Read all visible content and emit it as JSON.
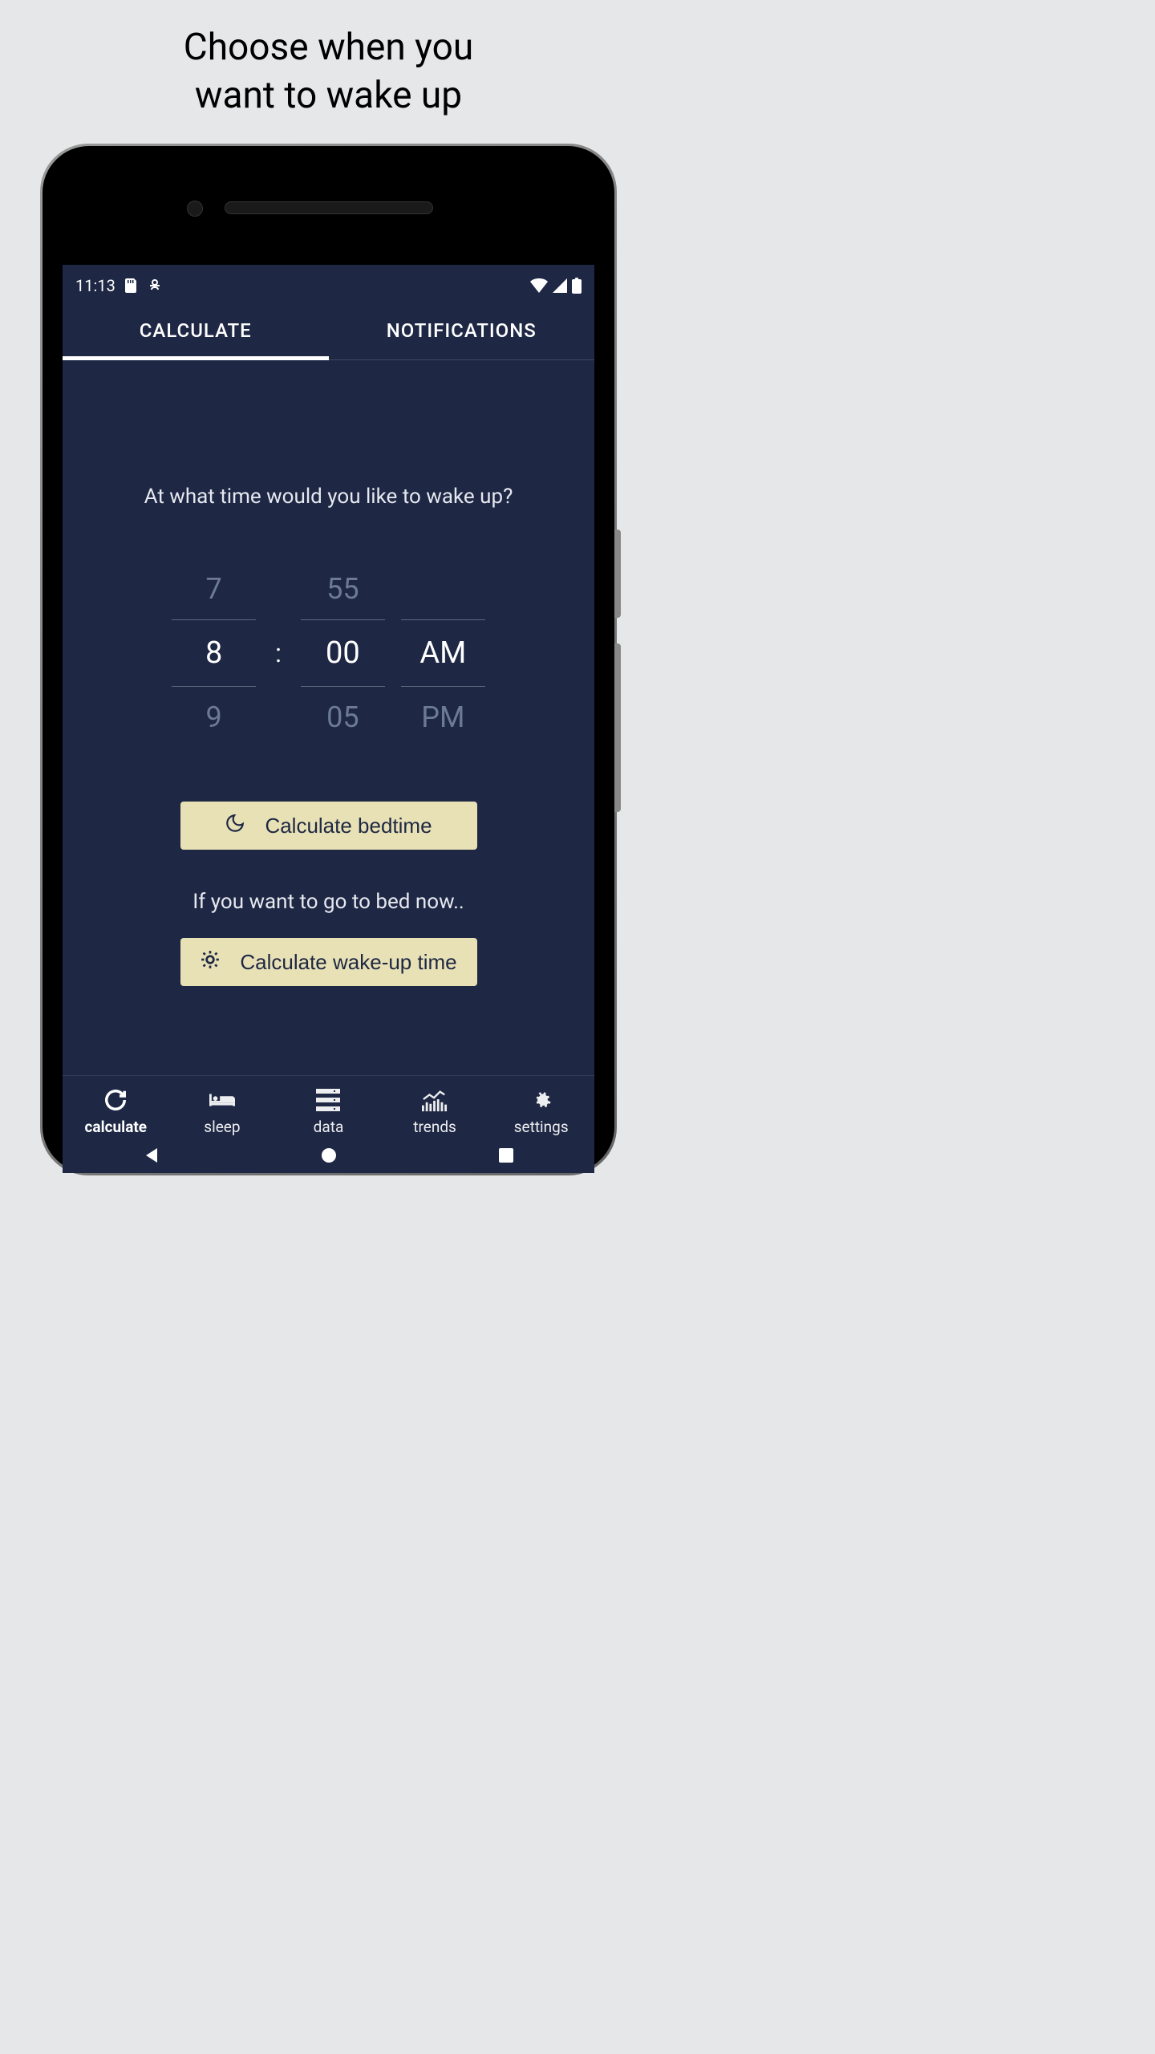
{
  "page_title_line1": "Choose when you",
  "page_title_line2": "want to wake up",
  "status_bar": {
    "time": "11:13"
  },
  "tabs": {
    "calculate": "CALCULATE",
    "notifications": "NOTIFICATIONS"
  },
  "question": "At what time would you like to wake up?",
  "time_picker": {
    "hour_prev": "7",
    "hour_selected": "8",
    "hour_next": "9",
    "minute_prev": "55",
    "minute_selected": "00",
    "minute_next": "05",
    "period_selected": "AM",
    "period_next": "PM",
    "separator": ":"
  },
  "buttons": {
    "calculate_bedtime": "Calculate bedtime",
    "calculate_wakeup": "Calculate wake-up time"
  },
  "alt_text": "If you want to go to bed now..",
  "bottom_nav": {
    "calculate": "calculate",
    "sleep": "sleep",
    "data": "data",
    "trends": "trends",
    "settings": "settings"
  }
}
